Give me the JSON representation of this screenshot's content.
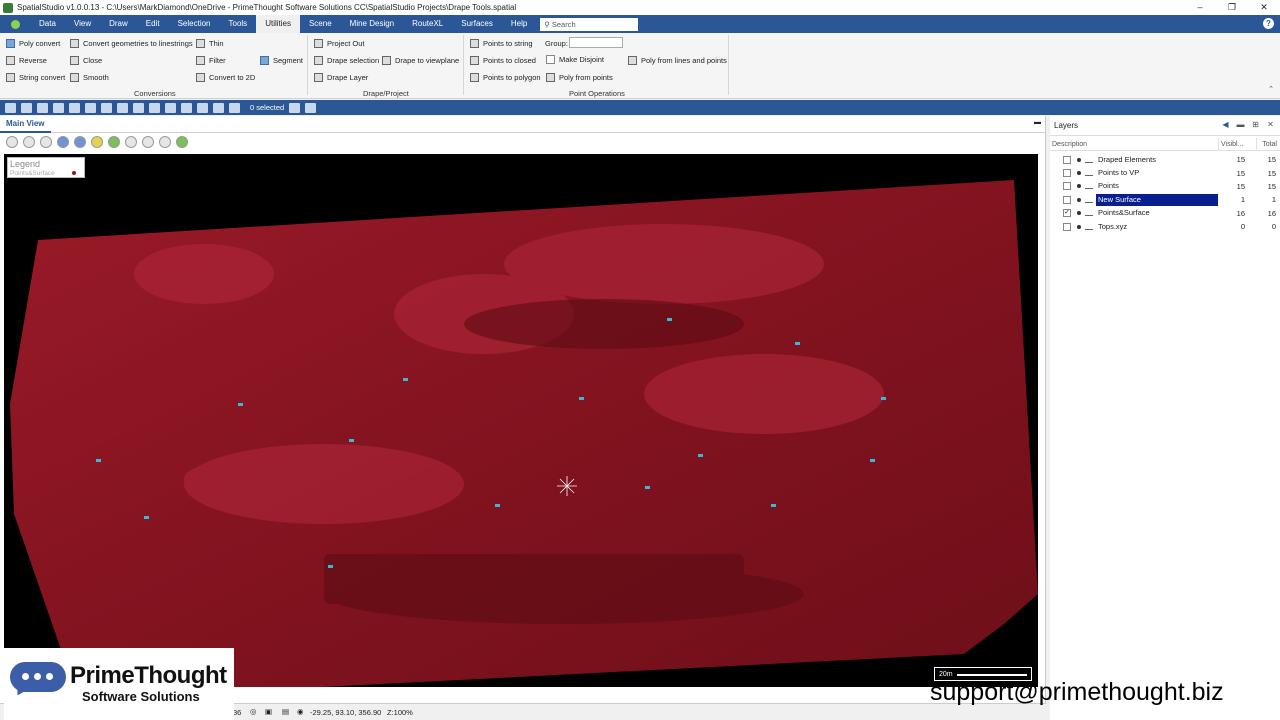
{
  "window": {
    "title": "SpatialStudio v1.0.0.13 - C:\\Users\\MarkDiamond\\OneDrive - PrimeThought Software Solutions CC\\SpatialStudio Projects\\Drape Tools.spatial"
  },
  "menu": {
    "items": [
      "Data",
      "View",
      "Draw",
      "Edit",
      "Selection",
      "Tools",
      "Utilities",
      "Scene",
      "Mine Design",
      "RouteXL",
      "Surfaces",
      "Help"
    ],
    "active": "Utilities",
    "search_placeholder": "Search"
  },
  "ribbon": {
    "conversions": {
      "label": "Conversions",
      "buttons": [
        "Poly convert",
        "Reverse",
        "String convert",
        "Convert geometries to linestrings",
        "Close",
        "Smooth",
        "Thin",
        "Filter",
        "Convert to 2D",
        "Segment"
      ]
    },
    "drape": {
      "label": "Drape/Project",
      "buttons": [
        "Project Out",
        "Drape selection",
        "Drape Layer",
        "Drape to viewplane"
      ]
    },
    "points": {
      "label": "Point Operations",
      "buttons": [
        "Points to string",
        "Points to closed",
        "Points to polygon",
        "Poly from points",
        "Poly from lines and points"
      ],
      "group_label": "Group:",
      "make_disjoint": "Make Disjoint"
    }
  },
  "toolbar2": {
    "selected": "0 selected"
  },
  "main_view": {
    "tab": "Main View"
  },
  "legend": {
    "title": "Legend",
    "item": "Points&Surface",
    "item_color": "#a01020"
  },
  "scalebar": {
    "label": "20m"
  },
  "status": {
    "num": "36",
    "coords": "-29.25, 93.10, 356.90",
    "zoom": "Z:100%"
  },
  "layers": {
    "title": "Layers",
    "columns": {
      "description": "Description",
      "visible": "Visibl...",
      "total": "Total"
    },
    "rows": [
      {
        "name": "Draped Elements",
        "visible": "15",
        "total": "15",
        "checked": "",
        "selected": false
      },
      {
        "name": "Points to VP",
        "visible": "15",
        "total": "15",
        "checked": "",
        "selected": false
      },
      {
        "name": "Points",
        "visible": "15",
        "total": "15",
        "checked": "",
        "selected": false
      },
      {
        "name": "New Surface",
        "visible": "1",
        "total": "1",
        "checked": "",
        "selected": true
      },
      {
        "name": "Points&Surface",
        "visible": "16",
        "total": "16",
        "checked": "✓",
        "selected": false
      },
      {
        "name": "Tops.xyz",
        "visible": "0",
        "total": "0",
        "checked": "",
        "selected": false
      }
    ]
  },
  "brand": {
    "line1": "PrimeThought",
    "line2": "Software Solutions"
  },
  "support_email": "support@primethought.biz",
  "colors": {
    "accent": "#2b5797",
    "surface": "#8a1522",
    "marker": "#3ab8d8"
  }
}
